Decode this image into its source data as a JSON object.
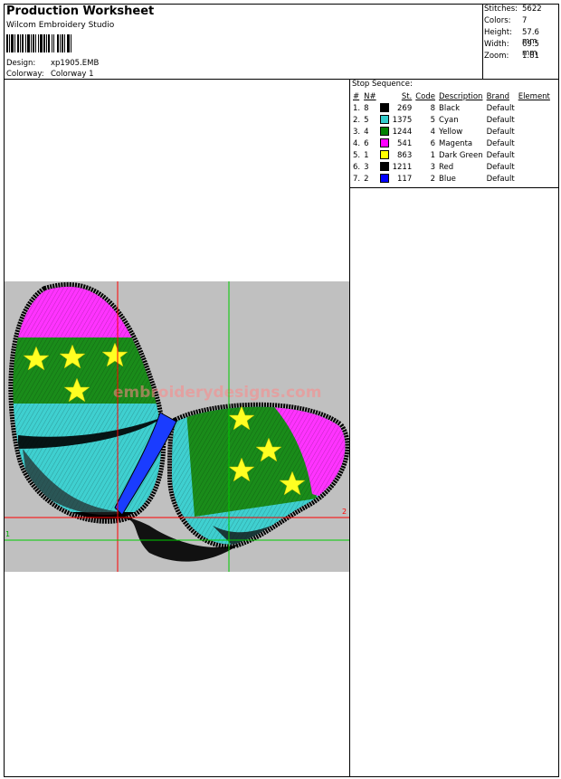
{
  "header": {
    "title": "Production Worksheet",
    "subtitle": "Wilcom  Embroidery Studio",
    "design_label": "Design:",
    "design_value": "xp1905.EMB",
    "colorway_label": "Colorway:",
    "colorway_value": "Colorway 1"
  },
  "stats": {
    "stitches_label": "Stitches:",
    "stitches_value": "5622",
    "colors_label": "Colors:",
    "colors_value": "7",
    "height_label": "Height:",
    "height_value": "57.6 mm",
    "width_label": "Width:",
    "width_value": "69.5 mm",
    "zoom_label": "Zoom:",
    "zoom_value": "1.81"
  },
  "stop_sequence": {
    "title": "Stop Sequence:",
    "headers": [
      "#",
      "N#",
      "St.",
      "Code",
      "Description",
      "Brand",
      "Element"
    ],
    "rows": [
      {
        "idx": "1.",
        "n": "8",
        "color": "#000000",
        "st": "269",
        "code": "8",
        "desc": "Black",
        "brand": "Default"
      },
      {
        "idx": "2.",
        "n": "5",
        "color": "#33cccc",
        "st": "1375",
        "code": "5",
        "desc": "Cyan",
        "brand": "Default"
      },
      {
        "idx": "3.",
        "n": "4",
        "color": "#008000",
        "st": "1244",
        "code": "4",
        "desc": "Yellow",
        "brand": "Default"
      },
      {
        "idx": "4.",
        "n": "6",
        "color": "#ff00ff",
        "st": "541",
        "code": "6",
        "desc": "Magenta",
        "brand": "Default"
      },
      {
        "idx": "5.",
        "n": "1",
        "color": "#ffff00",
        "st": "863",
        "code": "1",
        "desc": "Dark Green",
        "brand": "Default"
      },
      {
        "idx": "6.",
        "n": "3",
        "color": "#000000",
        "st": "1211",
        "code": "3",
        "desc": "Red",
        "brand": "Default"
      },
      {
        "idx": "7.",
        "n": "2",
        "color": "#0000ff",
        "st": "117",
        "code": "2",
        "desc": "Blue",
        "brand": "Default"
      }
    ]
  },
  "canvas": {
    "marker_red": "2",
    "marker_green": "1",
    "watermark": "embroiderydesigns.com",
    "background": "#c0c0c0",
    "colors": {
      "magenta": "#ff33ff",
      "green": "#1a8c1a",
      "cyan": "#3fd0d0",
      "yellow": "#ffff22",
      "blue": "#1a3cff",
      "black": "#000000",
      "red_guide": "#ff0000",
      "green_guide": "#00cc00"
    }
  }
}
